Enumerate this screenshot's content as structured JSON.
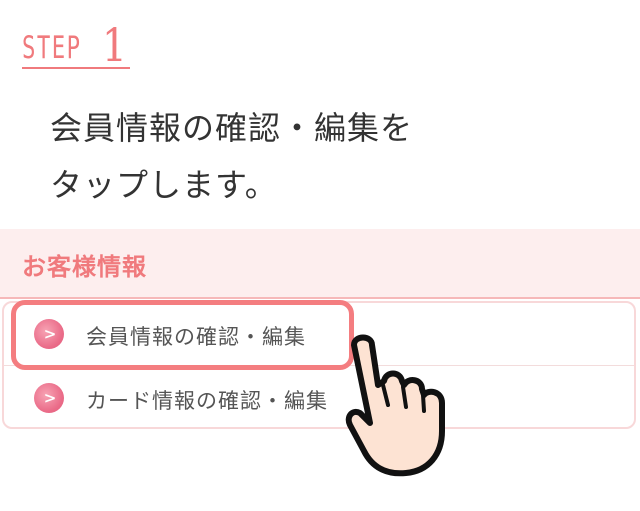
{
  "step": {
    "word": "STEP",
    "number": "1"
  },
  "instruction": {
    "line1": "会員情報の確認・編集を",
    "line2": "タップします。"
  },
  "section": {
    "title": "お客様情報"
  },
  "menu": {
    "items": [
      {
        "label": "会員情報の確認・編集",
        "icon": "chevron-right-icon"
      },
      {
        "label": "カード情報の確認・編集",
        "icon": "chevron-right-icon"
      }
    ],
    "bullet_glyph": ">"
  },
  "colors": {
    "accent": "#f07a7d",
    "section_bg": "#fdeeee",
    "bullet": "#ea6b88",
    "hand_fill": "#fde3d3"
  },
  "icons": {
    "hand": "pointing-hand-icon"
  }
}
